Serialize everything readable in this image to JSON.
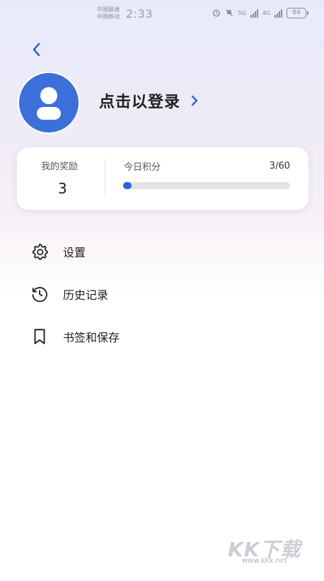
{
  "status_bar": {
    "carrier_1": "中国联通",
    "carrier_2": "中国移动",
    "time": "2:33",
    "network_1": "5G",
    "network_2": "4G",
    "battery": "84"
  },
  "header": {
    "back_icon": "chevron-left-icon"
  },
  "profile": {
    "avatar_icon": "user-avatar-icon",
    "login_label": "点击以登录",
    "login_chevron": "chevron-right-icon"
  },
  "reward_card": {
    "rewards_title": "我的奖励",
    "rewards_count": "3",
    "points_title": "今日积分",
    "points_value": "3/60",
    "points_progress": 0.05
  },
  "menu": {
    "items": [
      {
        "label": "设置",
        "icon": "gear-icon"
      },
      {
        "label": "历史记录",
        "icon": "history-icon"
      },
      {
        "label": "书签和保存",
        "icon": "bookmark-icon"
      }
    ]
  },
  "watermark": {
    "logo": "KK下载",
    "url": "www.kkx.net"
  },
  "colors": {
    "accent": "#2f63d8",
    "avatar_bg": "#3c6fd8",
    "progress_track": "#e3e3e3"
  }
}
